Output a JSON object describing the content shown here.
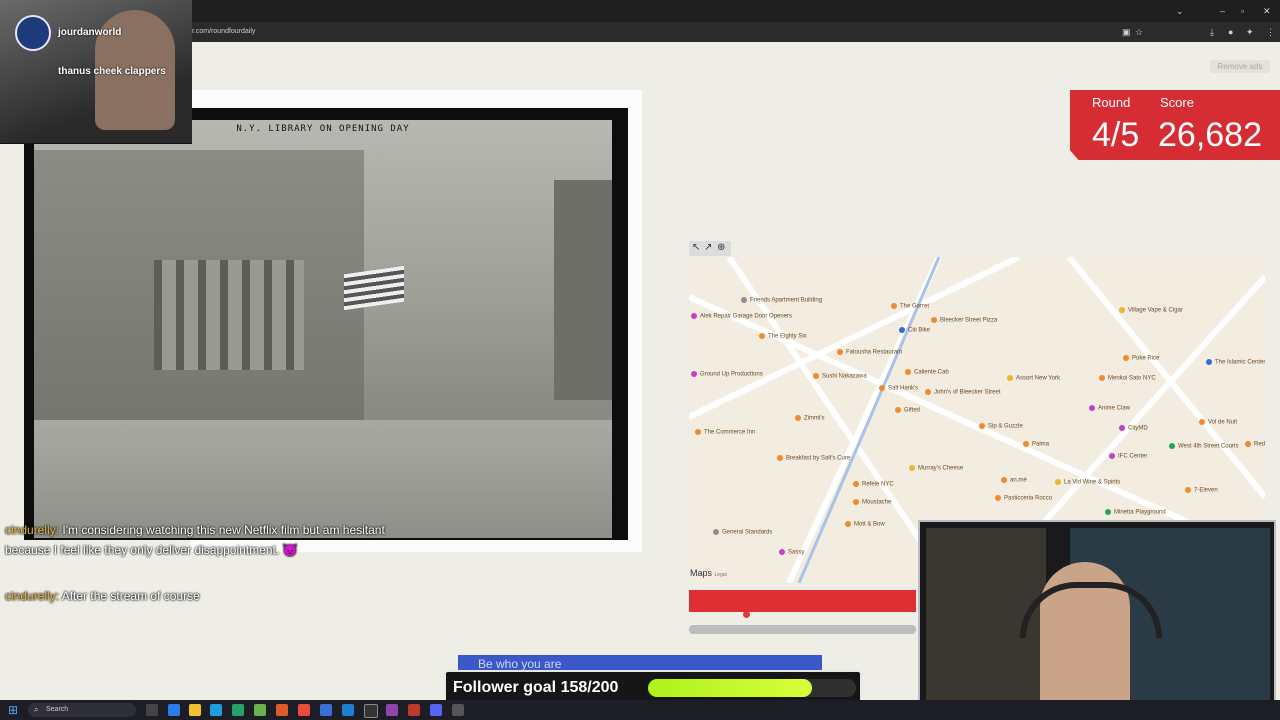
{
  "browser": {
    "url": "r.com/roundfourdaily",
    "controls": [
      "⌄",
      "–",
      "▫",
      "✕"
    ]
  },
  "page": {
    "remove_ads": "Remove ads",
    "photo_caption": "N.Y. LIBRARY ON OPENING DAY",
    "score": {
      "round_label": "Round",
      "score_label": "Score",
      "round_value": "4/5",
      "score_value": "26,682"
    },
    "map": {
      "provider": "Maps",
      "legal": "Legal",
      "pois": [
        "Friends Apartment Building",
        "The Garret",
        "Bleecker Street Pizza",
        "Alek Repair Garage Door Openers",
        "The Eighty Six",
        "Citi Bike",
        "Village Vape & Cigar",
        "Fatousha Restaurant",
        "Poke Rice",
        "The Islamic Center at New York University",
        "Ground Up Productions",
        "Sushi Nakazawa",
        "Caliente Cab",
        "Assort New York",
        "Menkoi Sato NYC",
        "Salt Hank's",
        "John's of Bleecker Street",
        "Gifted",
        "Anime Claw",
        "Zimmi's",
        "Sip & Guzzle",
        "Vol de Nuit",
        "The Commerce Inn",
        "CityMD",
        "Palma",
        "West 4th Street Courts",
        "Breakfast by Salt's Cure",
        "IFC Center",
        "Murray's Cheese",
        "Refele NYC",
        "an.mé",
        "La Vid Wine & Spirits",
        "7-Eleven",
        "Moustache",
        "Pasticceria Rocco",
        "Mott & Bow",
        "Minetta Playground",
        "General Standards",
        "Sassy",
        "Red Ba"
      ]
    },
    "progress_fraction": 0.25
  },
  "stream": {
    "cam1_user": "jourdanworld",
    "cam1_message": "thanus cheek clappers",
    "chat": [
      {
        "user": "cindurelly:",
        "text": "I'm considering watching this new Netflix film but am hesitant because I feel like they only deliver disappointment."
      },
      {
        "user": "cindurelly:",
        "text": "After the stream of course"
      }
    ],
    "banner_back": "Be who you are",
    "follower_goal": {
      "label": "Follower goal 158/200",
      "current": 158,
      "target": 200
    }
  },
  "taskbar": {
    "search": "Search"
  },
  "colors": {
    "accent": "#d62d35",
    "goal_fill": "#c6ff26"
  }
}
